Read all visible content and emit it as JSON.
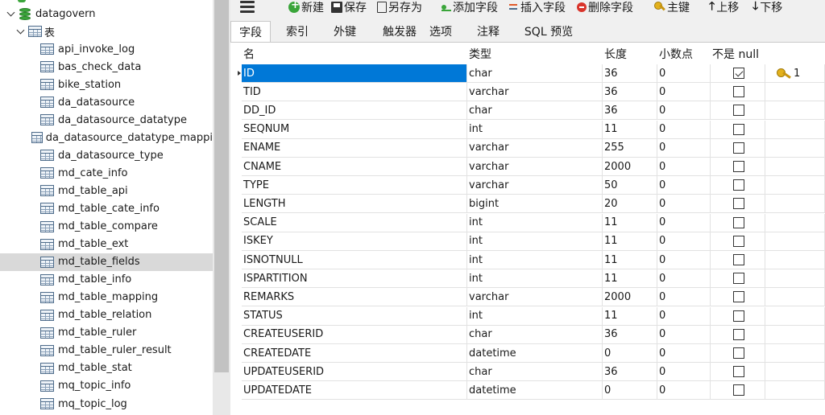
{
  "tree": {
    "database": "datagovern",
    "tables_folder": "表",
    "tables": [
      "api_invoke_log",
      "bas_check_data",
      "bike_station",
      "da_datasource",
      "da_datasource_datatype",
      "da_datasource_datatype_mappi",
      "da_datasource_type",
      "md_cate_info",
      "md_table_api",
      "md_table_cate_info",
      "md_table_compare",
      "md_table_ext",
      "md_table_fields",
      "md_table_info",
      "md_table_mapping",
      "md_table_relation",
      "md_table_ruler",
      "md_table_ruler_result",
      "md_table_stat",
      "mq_topic_info",
      "mq_topic_log"
    ],
    "selected": "md_table_fields"
  },
  "toolbar": {
    "new": "新建",
    "save": "保存",
    "save_as": "另存为",
    "add_field": "添加字段",
    "insert_field": "插入字段",
    "delete_field": "删除字段",
    "primary_key": "主键",
    "move_up": "上移",
    "move_down": "下移"
  },
  "tabs": [
    "字段",
    "索引",
    "外键",
    "触发器",
    "选项",
    "注释",
    "SQL 预览"
  ],
  "active_tab": "字段",
  "grid": {
    "headers": {
      "name": "名",
      "type": "类型",
      "length": "长度",
      "decimals": "小数点",
      "not_null": "不是 null",
      "key": ""
    },
    "rows": [
      {
        "name": "ID",
        "type": "char",
        "length": "36",
        "decimals": "0",
        "not_null": true,
        "key": "1"
      },
      {
        "name": "TID",
        "type": "varchar",
        "length": "36",
        "decimals": "0",
        "not_null": false,
        "key": ""
      },
      {
        "name": "DD_ID",
        "type": "char",
        "length": "36",
        "decimals": "0",
        "not_null": false,
        "key": ""
      },
      {
        "name": "SEQNUM",
        "type": "int",
        "length": "11",
        "decimals": "0",
        "not_null": false,
        "key": ""
      },
      {
        "name": "ENAME",
        "type": "varchar",
        "length": "255",
        "decimals": "0",
        "not_null": false,
        "key": ""
      },
      {
        "name": "CNAME",
        "type": "varchar",
        "length": "2000",
        "decimals": "0",
        "not_null": false,
        "key": ""
      },
      {
        "name": "TYPE",
        "type": "varchar",
        "length": "50",
        "decimals": "0",
        "not_null": false,
        "key": ""
      },
      {
        "name": "LENGTH",
        "type": "bigint",
        "length": "20",
        "decimals": "0",
        "not_null": false,
        "key": ""
      },
      {
        "name": "SCALE",
        "type": "int",
        "length": "11",
        "decimals": "0",
        "not_null": false,
        "key": ""
      },
      {
        "name": "ISKEY",
        "type": "int",
        "length": "11",
        "decimals": "0",
        "not_null": false,
        "key": ""
      },
      {
        "name": "ISNOTNULL",
        "type": "int",
        "length": "11",
        "decimals": "0",
        "not_null": false,
        "key": ""
      },
      {
        "name": "ISPARTITION",
        "type": "int",
        "length": "11",
        "decimals": "0",
        "not_null": false,
        "key": ""
      },
      {
        "name": "REMARKS",
        "type": "varchar",
        "length": "2000",
        "decimals": "0",
        "not_null": false,
        "key": ""
      },
      {
        "name": "STATUS",
        "type": "int",
        "length": "11",
        "decimals": "0",
        "not_null": false,
        "key": ""
      },
      {
        "name": "CREATEUSERID",
        "type": "char",
        "length": "36",
        "decimals": "0",
        "not_null": false,
        "key": ""
      },
      {
        "name": "CREATEDATE",
        "type": "datetime",
        "length": "0",
        "decimals": "0",
        "not_null": false,
        "key": ""
      },
      {
        "name": "UPDATEUSERID",
        "type": "char",
        "length": "36",
        "decimals": "0",
        "not_null": false,
        "key": ""
      },
      {
        "name": "UPDATEDATE",
        "type": "datetime",
        "length": "0",
        "decimals": "0",
        "not_null": false,
        "key": ""
      }
    ],
    "selected_row": 0
  },
  "colors": {
    "selection": "#0078d7",
    "tree_selected": "#d9d9d9",
    "db_icon": "#3aa53a"
  }
}
